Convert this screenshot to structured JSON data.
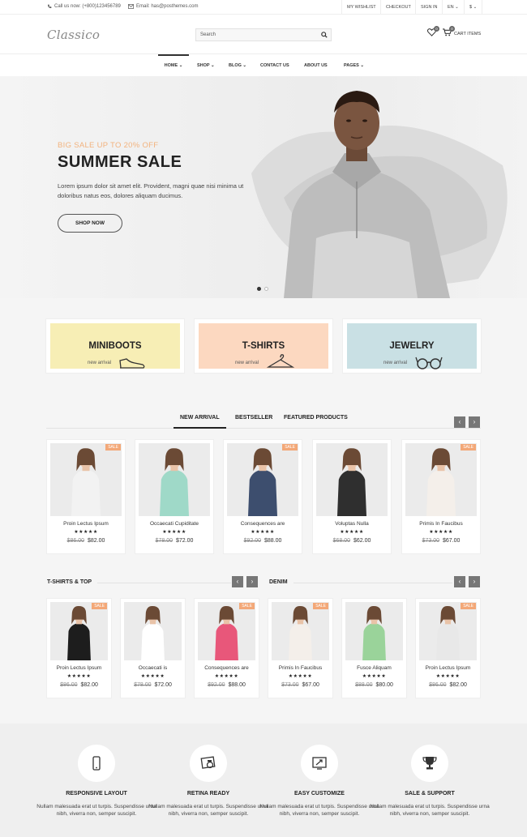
{
  "topbar": {
    "phone": "Call us now: (+800)123456789",
    "email": "Email: has@posthemes.com",
    "links": [
      "MY WISHLIST",
      "CHECKOUT",
      "SIGN IN",
      "EN ⌄",
      "$ ⌄"
    ]
  },
  "header": {
    "logo": "Classico",
    "search_placeholder": "Search",
    "wishlist_count": "0",
    "cart_count": "0",
    "cart_label": "CART ITEMS"
  },
  "nav": [
    "HOME ⌄",
    "SHOP ⌄",
    "BLOG ⌄",
    "CONTACT US",
    "ABOUT US",
    "PAGES ⌄"
  ],
  "hero": {
    "small": "BIG SALE UP TO 20% OFF",
    "title": "SUMMER SALE",
    "desc": "Lorem ipsum dolor sit amet elit. Provident, magni quae nisi minima ut doloribus natus eos, dolores aliquam ducimus.",
    "button": "SHOP NOW"
  },
  "categories": [
    {
      "title": "MINIBOOTS",
      "sub": "new arrival",
      "color": "#f7eeb5",
      "icon": "shoe-icon"
    },
    {
      "title": "T-SHIRTS",
      "sub": "new arrival",
      "color": "#fcd8c0",
      "icon": "hanger-icon"
    },
    {
      "title": "JEWELRY",
      "sub": "new arrival",
      "color": "#c9e0e4",
      "icon": "glasses-icon"
    }
  ],
  "tabs": [
    "NEW ARRIVAL",
    "BESTSELLER",
    "FEATURED PRODUCTS"
  ],
  "products_row1": [
    {
      "name": "Proin Lectus Ipsum",
      "old": "$86.00",
      "price": "$82.00",
      "sale": "SALE",
      "stars": "★★★★★"
    },
    {
      "name": "Occaecati Cupiditate",
      "old": "$78.00",
      "price": "$72.00",
      "sale": "",
      "stars": "★★★★★"
    },
    {
      "name": "Consequences are",
      "old": "$92.00",
      "price": "$88.00",
      "sale": "SALE",
      "stars": "★★★★★"
    },
    {
      "name": "Voluptas Nulla",
      "old": "$68.00",
      "price": "$62.00",
      "sale": "",
      "stars": "★★★★★"
    },
    {
      "name": "Primis In Faucibus",
      "old": "$73.00",
      "price": "$67.00",
      "sale": "SALE",
      "stars": "★★★★★"
    }
  ],
  "section_tshirts": "T-SHIRTS & TOP",
  "section_denim": "DENIM",
  "products_row2": [
    {
      "name": "Proin Lectus Ipsum",
      "old": "$86.00",
      "price": "$82.00",
      "sale": "SALE",
      "stars": "★★★★★"
    },
    {
      "name": "Occaecati is",
      "old": "$78.00",
      "price": "$72.00",
      "sale": "",
      "stars": "★★★★★"
    },
    {
      "name": "Consequences are",
      "old": "$92.00",
      "price": "$88.00",
      "sale": "SALE",
      "stars": "★★★★★"
    },
    {
      "name": "Primis In Faucibus",
      "old": "$73.00",
      "price": "$67.00",
      "sale": "SALE",
      "stars": "★★★★★"
    },
    {
      "name": "Fusce Aliquam",
      "old": "$88.00",
      "price": "$80.00",
      "sale": "",
      "stars": "★★★★★"
    },
    {
      "name": "Proin Lectus Ipsum",
      "old": "$86.00",
      "price": "$82.00",
      "sale": "SALE",
      "stars": "★★★★★"
    }
  ],
  "features": [
    {
      "title": "RESPONSIVE LAYOUT",
      "desc": "Nullam malesuada erat ut turpis. Suspendisse urna nibh, viverra non, semper suscipit.",
      "icon": "mobile-icon"
    },
    {
      "title": "RETINA READY",
      "desc": "Nullam malesuada erat ut turpis. Suspendisse urna nibh, viverra non, semper suscipit.",
      "icon": "retina-icon"
    },
    {
      "title": "EASY CUSTOMIZE",
      "desc": "Nullam malesuada erat ut turpis. Suspendisse urna nibh, viverra non, semper suscipit.",
      "icon": "customize-icon"
    },
    {
      "title": "SALE & SUPPORT",
      "desc": "Nullam malesuada erat ut turpis. Suspendisse urna nibh, viverra non, semper suscipit.",
      "icon": "trophy-icon"
    }
  ]
}
